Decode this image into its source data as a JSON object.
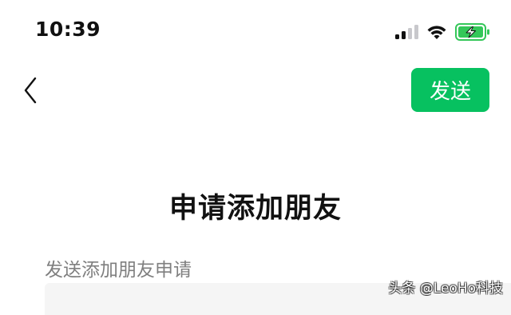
{
  "status_bar": {
    "time": "10:39",
    "signal_bars_active": 2,
    "signal_bars_total": 4,
    "wifi_icon": "wifi-icon",
    "battery_icon": "battery-charging-icon",
    "battery_color": "#34c759"
  },
  "nav": {
    "back_icon": "chevron-left-icon",
    "send_label": "发送",
    "send_color": "#07c160"
  },
  "page": {
    "title": "申请添加朋友"
  },
  "form": {
    "message_label": "发送添加朋友申请",
    "message_value": ""
  },
  "watermark": {
    "text": "头条 @LeoHo科技"
  }
}
